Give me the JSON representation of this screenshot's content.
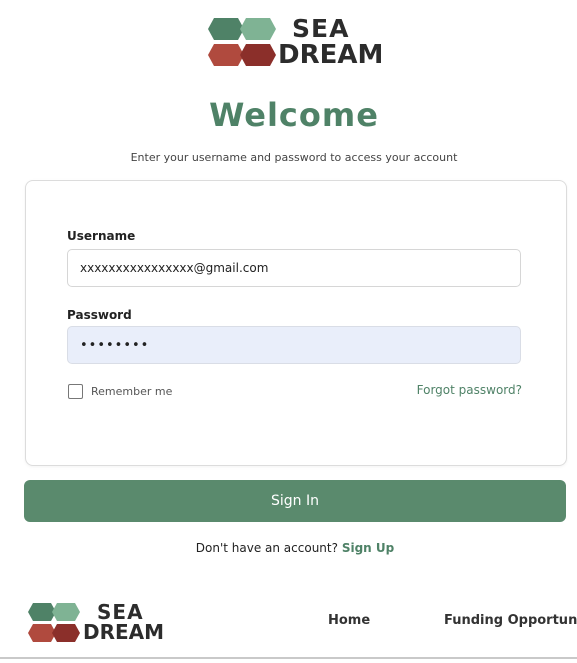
{
  "brand": {
    "line1": "SEA",
    "line2": "DREAM",
    "colors": {
      "green": "#4f8267",
      "green_light": "#7fb394",
      "red": "#b04a3e",
      "red_dark": "#8b2f2a"
    }
  },
  "heading": "Welcome",
  "subtitle": "Enter your username and password to access your account",
  "form": {
    "username_label": "Username",
    "username_value": "xxxxxxxxxxxxxxxx@gmail.com",
    "password_label": "Password",
    "password_value": "••••••••",
    "remember_label": "Remember me",
    "remember_checked": false,
    "forgot_label": "Forgot password?",
    "submit_label": "Sign In"
  },
  "signup": {
    "prompt": "Don't have an account?",
    "link": "Sign Up"
  },
  "navbar": {
    "items": [
      {
        "label": "Home"
      },
      {
        "label": "Funding Opportuni"
      }
    ]
  }
}
